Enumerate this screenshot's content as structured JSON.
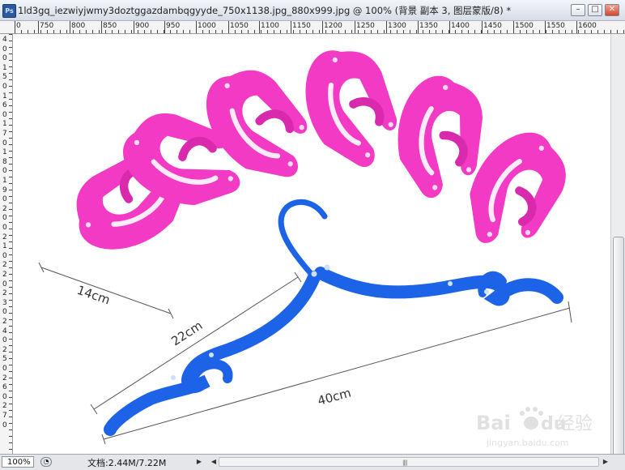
{
  "window": {
    "app_icon": "Ps",
    "title": "1ld3gq_iezwiyjwmy3doztggazdambqgyyde_750x1138.jpg_880x999.jpg @ 100% (背景 副本 3, 图层蒙版/8) *",
    "buttons": {
      "minimize": "–",
      "maximize": "□",
      "close": "✕"
    }
  },
  "ruler": {
    "h_labels": [
      "0",
      "750",
      "800",
      "850",
      "900",
      "950",
      "1000",
      "1050",
      "1100",
      "1150",
      "1200",
      "1250",
      "1300",
      "1350",
      "1400",
      "1450",
      "1500",
      "1550",
      "1600"
    ],
    "v_labels": [
      "4",
      "0",
      "0",
      "1",
      "5",
      "0",
      "1",
      "6",
      "0",
      "1",
      "7",
      "0",
      "1",
      "8",
      "0",
      "1",
      "9",
      "0",
      "2",
      "0",
      "0",
      "2",
      "1",
      "0",
      "2",
      "2",
      "0",
      "2",
      "3",
      "0",
      "2",
      "4",
      "0",
      "2",
      "5",
      "0",
      "2",
      "6",
      "0",
      "2",
      "7",
      "0"
    ]
  },
  "image": {
    "dimensions": {
      "width_label": "14cm",
      "height_label": "22cm",
      "length_label": "40cm"
    },
    "watermark": {
      "brand": "Bai",
      "brand_suffix": "du",
      "product": "经验",
      "url": "jingyan.baidu.com"
    },
    "colors": {
      "pink": "#f23ac5",
      "blue": "#1c63e8"
    }
  },
  "status": {
    "zoom": "100%",
    "doc_label": "文档:",
    "doc_size": "2.44M/7.22M",
    "arrow": "▶",
    "arrow_left": "◀",
    "arrow_right": "▶"
  }
}
